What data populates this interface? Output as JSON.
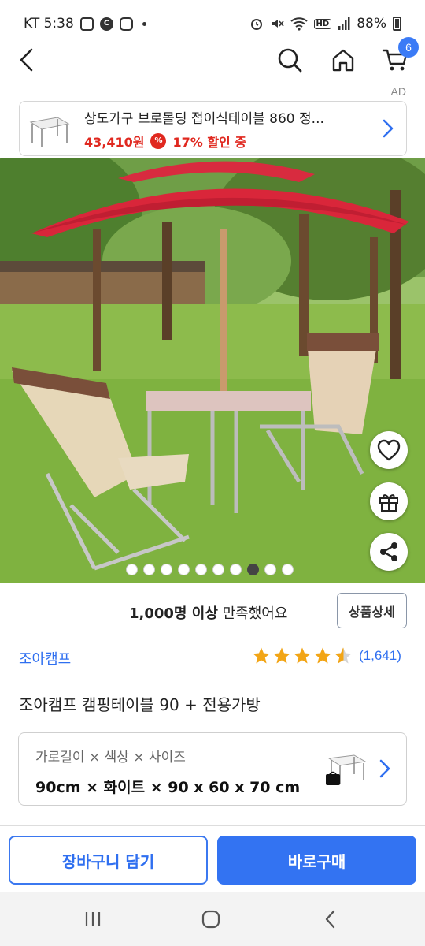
{
  "status_bar": {
    "carrier_time": "KT 5:38",
    "battery": "88%",
    "icons": [
      "gallery-icon",
      "c-icon",
      "instagram-icon",
      "alarm-icon",
      "mute-icon",
      "wifi-icon",
      "hd-icon",
      "signal-icon",
      "battery-icon"
    ]
  },
  "nav": {
    "cart_count": "6"
  },
  "ad": {
    "label": "AD",
    "title": "상도가구 브로몰딩 접이식테이블 860 정...",
    "price": "43,410원",
    "discount_badge": "%",
    "discount": "17% 할인 중"
  },
  "gallery": {
    "total_images": 10,
    "active_index": 7
  },
  "summary": {
    "satisfaction_bold": "1,000명 이상",
    "satisfaction_rest": " 만족했어요",
    "detail_button": "상품상세"
  },
  "product": {
    "brand": "조아캠프",
    "rating": 4.5,
    "review_count": "(1,641)",
    "title": "조아캠프 캠핑테이블 90 + 전용가방"
  },
  "option": {
    "label": "가로길이 × 색상 × 사이즈",
    "value": "90cm × 화이트 × 90 x 60 x 70 cm"
  },
  "actions": {
    "add_to_cart": "장바구니 담기",
    "buy_now": "바로구매"
  },
  "colors": {
    "accent_blue": "#3373f2",
    "sale_red": "#e0281f",
    "star_gold": "#f2a516"
  }
}
